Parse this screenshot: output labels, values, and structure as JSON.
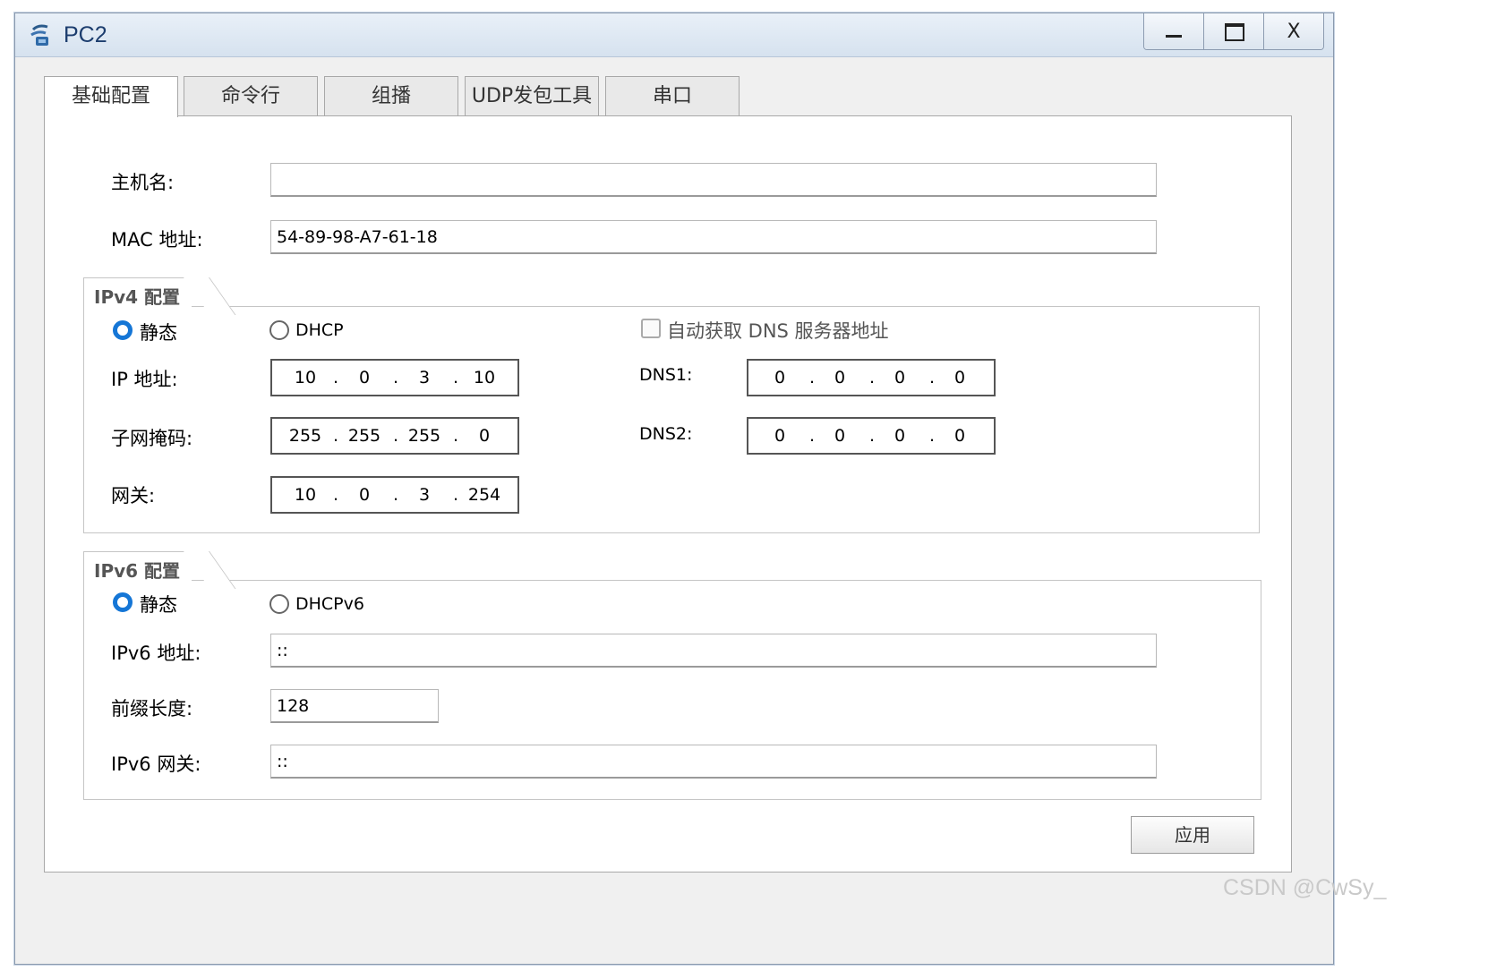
{
  "window": {
    "title": "PC2",
    "controls": {
      "minimize": "minimize-icon",
      "maximize": "maximize-icon",
      "close_label": "X"
    }
  },
  "tabs": [
    {
      "label": "基础配置",
      "active": true
    },
    {
      "label": "命令行",
      "active": false
    },
    {
      "label": "组播",
      "active": false
    },
    {
      "label": "UDP发包工具",
      "active": false
    },
    {
      "label": "串口",
      "active": false
    }
  ],
  "basic": {
    "hostname_label": "主机名:",
    "hostname_value": "",
    "mac_label": "MAC 地址:",
    "mac_value": "54-89-98-A7-61-18"
  },
  "ipv4": {
    "group_title": "IPv4 配置",
    "static_label": "静态",
    "static_selected": true,
    "dhcp_label": "DHCP",
    "auto_dns_label": "自动获取 DNS 服务器地址",
    "auto_dns_checked": false,
    "ip_label": "IP 地址:",
    "ip": [
      "10",
      "0",
      "3",
      "10"
    ],
    "mask_label": "子网掩码:",
    "mask": [
      "255",
      "255",
      "255",
      "0"
    ],
    "gateway_label": "网关:",
    "gateway": [
      "10",
      "0",
      "3",
      "254"
    ],
    "dns1_label": "DNS1:",
    "dns1": [
      "0",
      "0",
      "0",
      "0"
    ],
    "dns2_label": "DNS2:",
    "dns2": [
      "0",
      "0",
      "0",
      "0"
    ],
    "dot": "."
  },
  "ipv6": {
    "group_title": "IPv6 配置",
    "static_label": "静态",
    "static_selected": true,
    "dhcp_label": "DHCPv6",
    "addr_label": "IPv6 地址:",
    "addr_value": "::",
    "prefix_label": "前缀长度:",
    "prefix_value": "128",
    "gateway_label": "IPv6 网关:",
    "gateway_value": "::"
  },
  "apply_label": "应用",
  "watermark": "CSDN @CwSy_",
  "colors": {
    "radio_accent": "#1576d6",
    "title_text": "#1c3d6e"
  }
}
